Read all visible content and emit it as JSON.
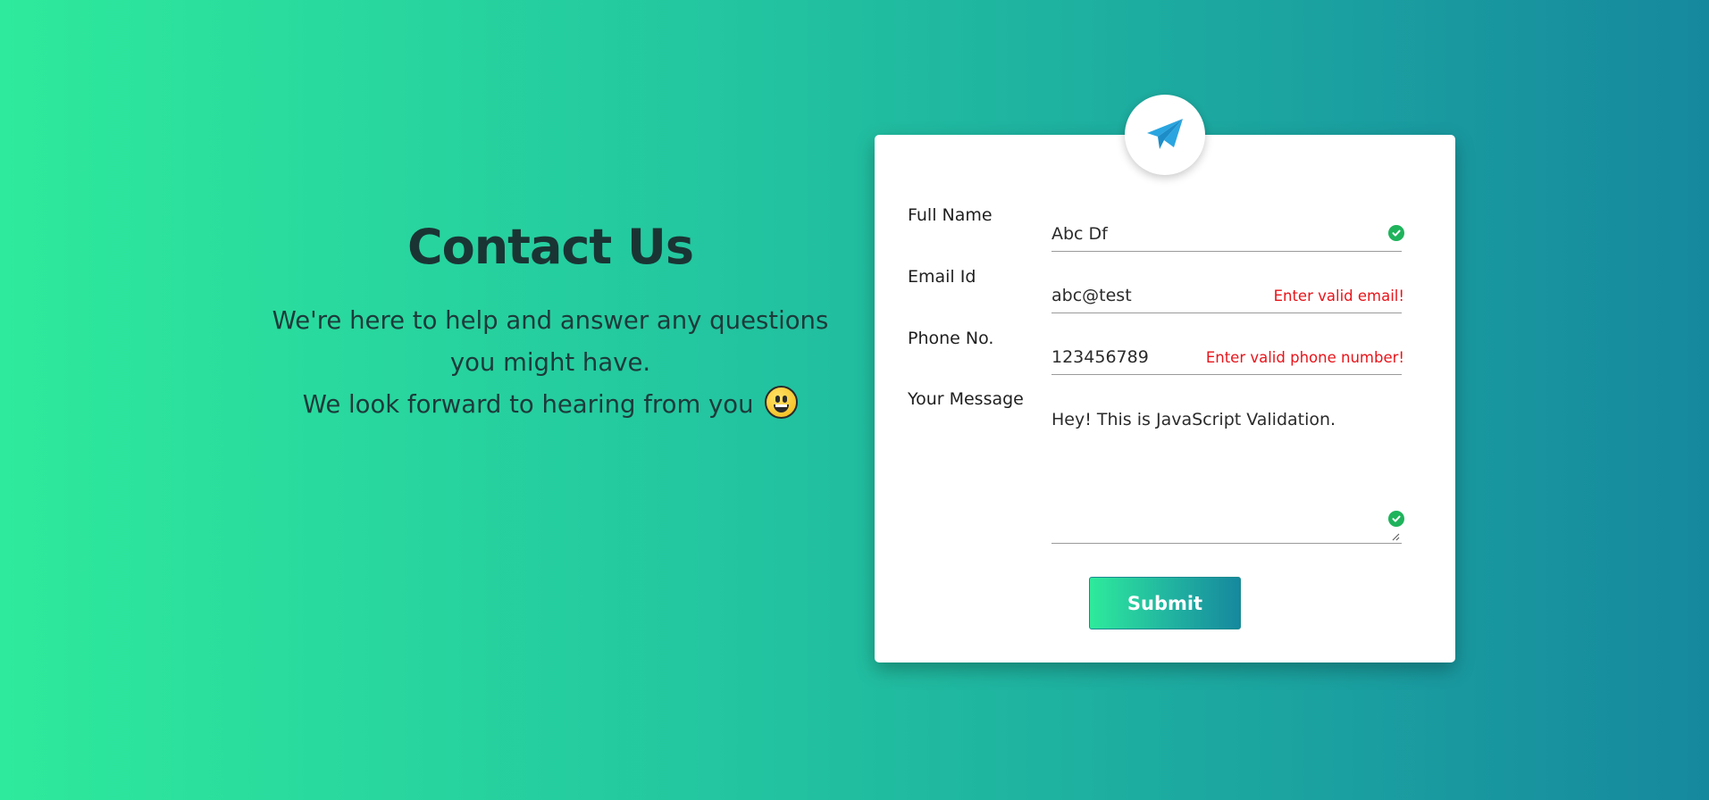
{
  "intro": {
    "title": "Contact Us",
    "line1": "We're here to help and answer any questions",
    "line2": "you might have.",
    "line3": "We look forward to hearing from you",
    "emoji": "grinning-face-icon"
  },
  "form": {
    "logo_icon": "paper-plane-icon",
    "fields": {
      "name": {
        "label": "Full Name",
        "value": "Abc Df",
        "status": "valid"
      },
      "email": {
        "label": "Email Id",
        "value": "abc@test",
        "status": "invalid",
        "error": "Enter valid email!"
      },
      "phone": {
        "label": "Phone No.",
        "value": "123456789",
        "status": "invalid",
        "error": "Enter valid phone number!"
      },
      "message": {
        "label": "Your Message",
        "value": "Hey! This is JavaScript Validation.",
        "status": "valid"
      }
    },
    "submit_label": "Submit"
  },
  "colors": {
    "gradient_start": "#2eea9c",
    "gradient_end": "#16889e",
    "error": "#e8141a",
    "valid": "#1fb35c",
    "logo_blue": "#2aa5e0"
  }
}
